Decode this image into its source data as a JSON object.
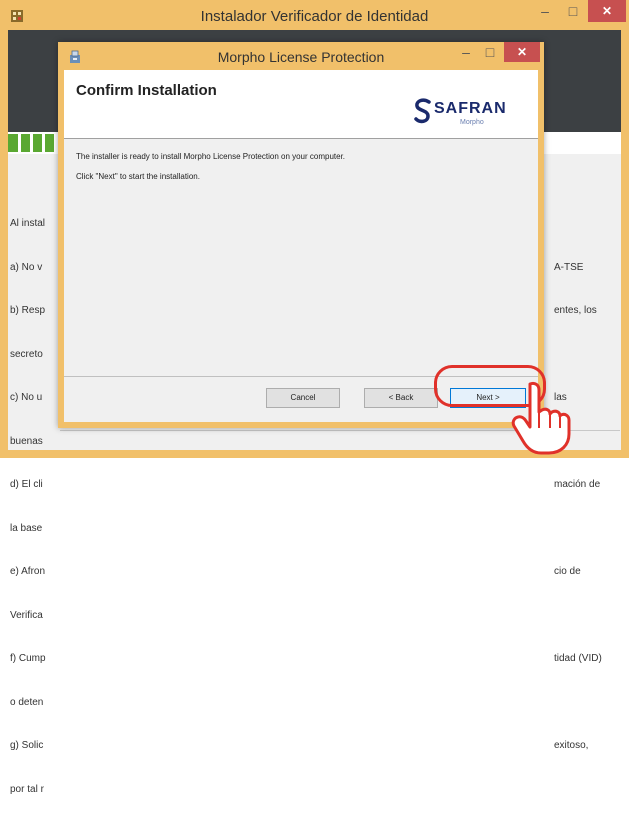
{
  "outer_window": {
    "title": "Instalador Verificador de Identidad",
    "controls": {
      "minimize": "–",
      "maximize": "□",
      "close": "✕"
    }
  },
  "background_text": {
    "left_lines": [
      "Al instal",
      "a) No v",
      "b) Resp",
      "secreto",
      "c) No u",
      "buenas",
      "d) El cli",
      "la base",
      "e) Afron",
      "Verifica",
      "f) Cump",
      "o deten",
      "g) Solic",
      "por tal r"
    ],
    "right_lines": [
      "",
      "A-TSE",
      "entes, los",
      "",
      "las",
      "",
      "mación de",
      "",
      "cio de",
      "",
      "tidad (VID)",
      "",
      "exitoso,",
      ""
    ]
  },
  "dialog": {
    "title": "Morpho License Protection",
    "controls": {
      "minimize": "–",
      "maximize": "□",
      "close": "✕"
    },
    "header_title": "Confirm Installation",
    "logo": {
      "word": "SAFRAN",
      "sub": "Morpho"
    },
    "message_1": "The installer is ready to install Morpho License Protection on your computer.",
    "message_2": "Click \"Next\" to start the installation.",
    "buttons": {
      "cancel": "Cancel",
      "back": "< Back",
      "next": "Next >"
    }
  },
  "colors": {
    "frame": "#f1c06a",
    "close_button": "#c75050",
    "highlight_ring": "#e0312a",
    "brand": "#1a2a6c",
    "progress_green": "#5aa832"
  }
}
